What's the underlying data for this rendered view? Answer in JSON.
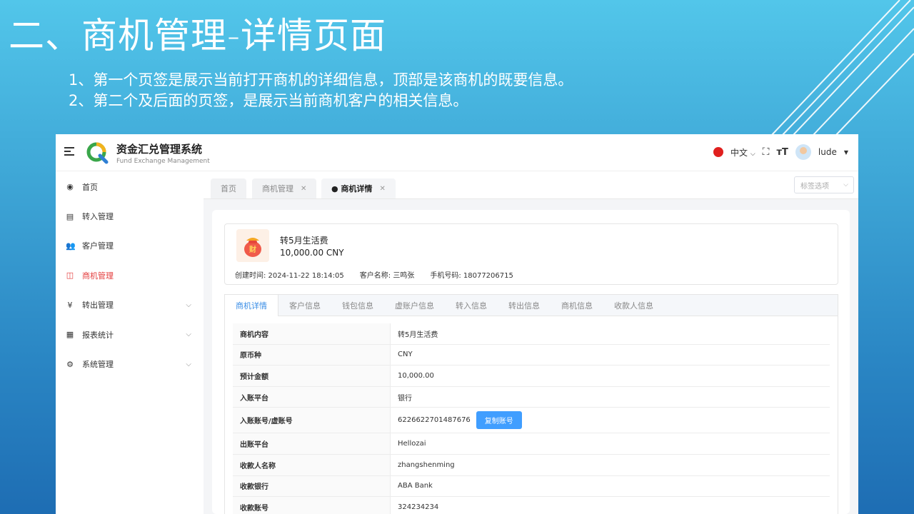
{
  "slide": {
    "title": "二、商机管理-详情页面",
    "notes": [
      "1、第一个页签是展示当前打开商机的详细信息，顶部是该商机的既要信息。",
      "2、第二个及后面的页签，是展示当前商机客户的相关信息。"
    ]
  },
  "header": {
    "app_name": "资金汇兑管理系统",
    "app_subtitle": "Fund Exchange Management",
    "language": "中文",
    "username": "lude"
  },
  "sidebar": {
    "items": [
      {
        "label": "首页",
        "icon": "dashboard-icon",
        "glyph": "◉"
      },
      {
        "label": "转入管理",
        "icon": "transfer-in-icon",
        "glyph": "▤"
      },
      {
        "label": "客户管理",
        "icon": "users-icon",
        "glyph": "👥"
      },
      {
        "label": "商机管理",
        "icon": "opportunity-icon",
        "glyph": "◫"
      },
      {
        "label": "转出管理",
        "icon": "yen-icon",
        "glyph": "¥"
      },
      {
        "label": "报表统计",
        "icon": "report-icon",
        "glyph": "▦"
      },
      {
        "label": "系统管理",
        "icon": "gear-icon",
        "glyph": "⚙"
      }
    ],
    "active_index": 3
  },
  "page_tabs": [
    {
      "label": "首页"
    },
    {
      "label": "商机管理"
    },
    {
      "label": "● 商机详情"
    }
  ],
  "tab_options_label": "标签选项",
  "summary": {
    "title": "转5月生活费",
    "amount": "10,000.00 CNY",
    "created_label": "创建时间: 2024-11-22 18:14:05",
    "customer_label": "客户名称: 三鸣张",
    "phone_label": "手机号码: 18077206715"
  },
  "detail_tabs": [
    "商机详情",
    "客户信息",
    "钱包信息",
    "虚账户信息",
    "转入信息",
    "转出信息",
    "商机信息",
    "收款人信息"
  ],
  "detail_rows": [
    {
      "key": "商机内容",
      "value": "转5月生活费"
    },
    {
      "key": "原币种",
      "value": "CNY"
    },
    {
      "key": "预计金额",
      "value": "10,000.00"
    },
    {
      "key": "入账平台",
      "value": "银行"
    },
    {
      "key": "入账账号/虚账号",
      "value": "6226622701487676",
      "button": "复制账号"
    },
    {
      "key": "出账平台",
      "value": "Hellozai"
    },
    {
      "key": "收款人名称",
      "value": "zhangshenming"
    },
    {
      "key": "收款银行",
      "value": "ABA Bank"
    },
    {
      "key": "收款账号",
      "value": "324234234"
    }
  ]
}
